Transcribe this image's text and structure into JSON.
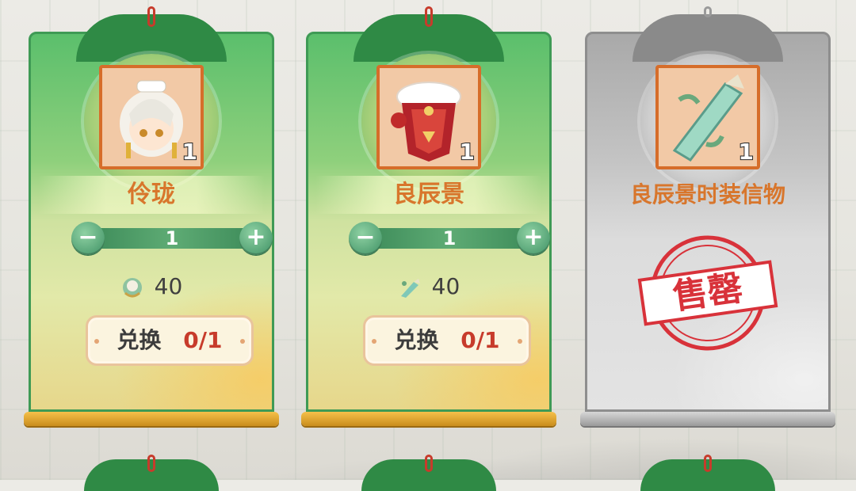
{
  "cards": [
    {
      "name": "伶珑",
      "state": "available",
      "item_quantity": "1",
      "stepper_value": "1",
      "price": "40",
      "price_icon": "character-token-icon",
      "redeem_label": "兑换",
      "redeem_count": "0/1",
      "item_icon": "white-haired-character-portrait"
    },
    {
      "name": "良辰景",
      "state": "available",
      "item_quantity": "1",
      "stepper_value": "1",
      "price": "40",
      "price_icon": "outfit-token-icon",
      "redeem_label": "兑换",
      "redeem_count": "0/1",
      "item_icon": "red-outfit-bundle"
    },
    {
      "name": "良辰景时装信物",
      "state": "sold-out",
      "item_quantity": "1",
      "sold_out_label": "售罄",
      "item_icon": "jade-token-item"
    }
  ],
  "colors": {
    "card_green": "#5bbf6c",
    "card_grey": "#b0b0b0",
    "name_orange": "#d8762c",
    "accent_red": "#c73b2b",
    "gold_rod": "#f6c04a"
  }
}
